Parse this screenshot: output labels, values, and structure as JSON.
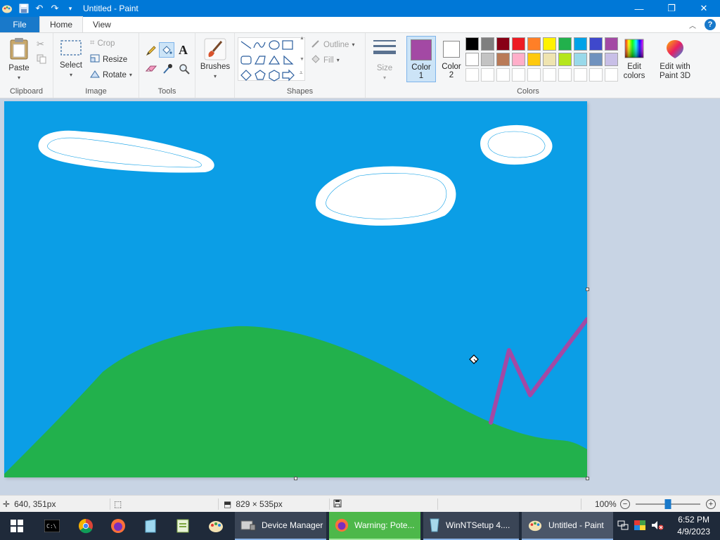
{
  "window": {
    "title": "Untitled - Paint",
    "buttons": {
      "minimize": "—",
      "maximize": "❐",
      "close": "✕"
    }
  },
  "tabs": {
    "file": "File",
    "home": "Home",
    "view": "View"
  },
  "ribbon": {
    "clipboard": {
      "label": "Clipboard",
      "paste": "Paste"
    },
    "image": {
      "label": "Image",
      "select": "Select",
      "crop": "Crop",
      "resize": "Resize",
      "rotate": "Rotate"
    },
    "tools": {
      "label": "Tools"
    },
    "brushes": {
      "label": "Brushes"
    },
    "shapes": {
      "label": "Shapes",
      "outline": "Outline",
      "fill": "Fill"
    },
    "size": {
      "label": "Size"
    },
    "colors": {
      "label": "Colors",
      "color1": "Color",
      "color1_num": "1",
      "color2": "Color",
      "color2_num": "2",
      "color1_value": "#a349a4",
      "color2_value": "#ffffff",
      "edit_colors": "Edit colors",
      "edit_colors_line1": "Edit",
      "edit_colors_line2": "colors",
      "paint3d_line1": "Edit with",
      "paint3d_line2": "Paint 3D",
      "palette_row1": [
        "#000000",
        "#7f7f7f",
        "#880015",
        "#ed1c24",
        "#ff7f27",
        "#fff200",
        "#22b14c",
        "#00a2e8",
        "#3f48cc",
        "#a349a4"
      ],
      "palette_row2": [
        "#ffffff",
        "#c3c3c3",
        "#b97a57",
        "#ffaec9",
        "#ffc90e",
        "#efe4b0",
        "#b5e61d",
        "#99d9ea",
        "#7092be",
        "#c8bfe7"
      ]
    }
  },
  "canvas": {
    "sky_color": "#0b9ee6",
    "hill_color": "#22b14c",
    "stroke_color": "#a349a4",
    "cloud_color": "#ffffff"
  },
  "status": {
    "cursor_pos": "640, 351px",
    "canvas_size": "829 × 535px",
    "zoom": "100%",
    "zoom_level": 0.5
  },
  "taskbar": {
    "apps": [
      {
        "label": "Device Manager"
      },
      {
        "label": "Warning: Pote..."
      },
      {
        "label": "WinNTSetup 4...."
      },
      {
        "label": "Untitled - Paint"
      }
    ],
    "time": "6:52 PM",
    "date": "4/9/2023"
  }
}
